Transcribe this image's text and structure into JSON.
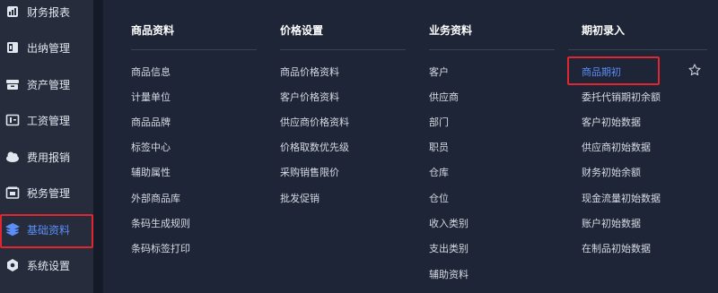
{
  "sidebar": {
    "items": [
      {
        "label": "财务报表",
        "icon": "report-icon"
      },
      {
        "label": "出纳管理",
        "icon": "cashier-icon"
      },
      {
        "label": "资产管理",
        "icon": "asset-icon"
      },
      {
        "label": "工资管理",
        "icon": "payroll-icon"
      },
      {
        "label": "费用报销",
        "icon": "expense-icon"
      },
      {
        "label": "税务管理",
        "icon": "tax-icon"
      },
      {
        "label": "基础资料",
        "icon": "layers-icon",
        "active": true
      },
      {
        "label": "系统设置",
        "icon": "settings-icon"
      }
    ]
  },
  "menu": {
    "columns": [
      {
        "title": "商品资料",
        "links": [
          "商品信息",
          "计量单位",
          "商品品牌",
          "标签中心",
          "辅助属性",
          "外部商品库",
          "条码生成规则",
          "条码标签打印"
        ]
      },
      {
        "title": "价格设置",
        "links": [
          "商品价格资料",
          "客户价格资料",
          "供应商价格资料",
          "价格取数优先级",
          "采购销售限价",
          "批发促销"
        ]
      },
      {
        "title": "业务资料",
        "links": [
          "客户",
          "供应商",
          "部门",
          "职员",
          "仓库",
          "仓位",
          "收入类别",
          "支出类别",
          "辅助资料"
        ]
      },
      {
        "title": "期初录入",
        "links": [
          "商品期初",
          "委托代销期初余额",
          "客户初始数据",
          "供应商初始数据",
          "财务初始余额",
          "现金流量初始数据",
          "账户初始数据",
          "在制品初始数据"
        ]
      }
    ],
    "favorite_icon": "star-icon"
  },
  "colors": {
    "sidebar_bg": "#262c3c",
    "panel_bg": "#1e2536",
    "accent": "#5b8ef7",
    "highlight_border": "#e0272f"
  }
}
